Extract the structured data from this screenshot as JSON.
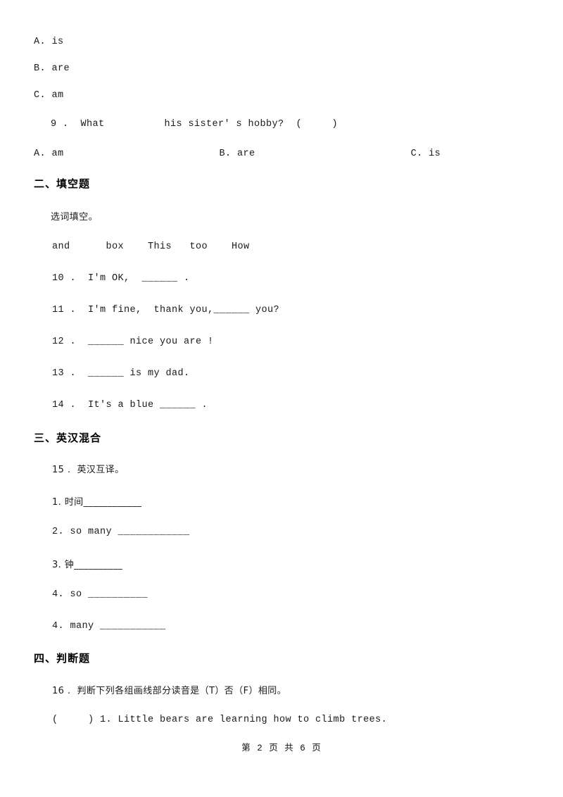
{
  "document": {
    "top_options": [
      "A. is",
      "B. are",
      "C. am"
    ],
    "question_9": {
      "text": "9 .  What          his sister' s hobby?  (     )",
      "options_line": "A. am                          B. are                          C. is"
    },
    "section_2": {
      "heading": "二、填空题",
      "instruction": "选词填空。",
      "word_bank": "and      box    This   too    How",
      "items": [
        "10 .  I'm OK,  ______ .",
        "11 .  I'm fine,  thank you,______ you?",
        "12 .  ______ nice you are !",
        "13 .  ______ is my dad.",
        "14 .  It's a blue ______ ."
      ]
    },
    "section_3": {
      "heading": "三、英汉混合",
      "item_title": "15 .  英汉互译。",
      "items": [
        "1. 时间____________",
        "2. so many ____________",
        "3. 钟__________",
        "4. so __________",
        "4. many ___________"
      ]
    },
    "section_4": {
      "heading": "四、判断题",
      "item_title": "16 .  判断下列各组画线部分读音是（T）否（F）相同。",
      "items": [
        "(     ) 1. Little bears are learning how to climb trees."
      ]
    },
    "footer": "第 2 页 共 6 页"
  }
}
